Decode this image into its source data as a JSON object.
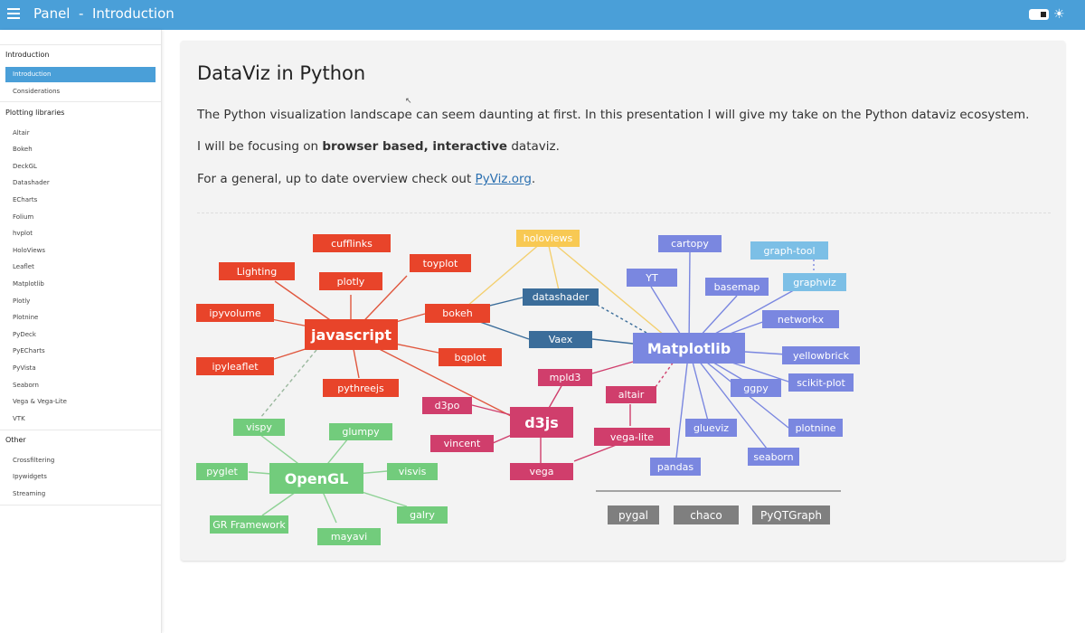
{
  "app": {
    "title": "Panel  -  Introduction"
  },
  "sidebar": {
    "sections": [
      {
        "title": "Introduction",
        "items": [
          "Introduction",
          "Considerations"
        ]
      },
      {
        "title": "Plotting libraries",
        "items": [
          "Altair",
          "Bokeh",
          "DeckGL",
          "Datashader",
          "ECharts",
          "Folium",
          "hvplot",
          "HoloViews",
          "Leaflet",
          "Matplotlib",
          "Plotly",
          "Plotnine",
          "PyDeck",
          "PyECharts",
          "PyVista",
          "Seaborn",
          "Vega & Vega-Lite",
          "VTK"
        ]
      },
      {
        "title": "Other",
        "items": [
          "Crossfiltering",
          "Ipywidgets",
          "Streaming"
        ]
      }
    ]
  },
  "main": {
    "heading": "DataViz in Python",
    "p1": "The Python visualization landscape can seem daunting at first. In this presentation I will give my take on the Python dataviz ecosystem.",
    "p2_pre": "I will be focusing on ",
    "p2_bold": "browser based, interactive",
    "p2_post": " dataviz.",
    "p3_pre": "For a general, up to date overview check out ",
    "p3_link": "PyViz.org",
    "p3_post": "."
  },
  "diagram": {
    "colors": {
      "red": "#e8442a",
      "pink": "#d03e6c",
      "green": "#72cc7c",
      "blue": "#7a87e0",
      "yellow": "#f8c953",
      "navy": "#3b6d9a",
      "light": "#7cbfe6",
      "gray": "#7f7f7f"
    },
    "nodes": {
      "javascript": "javascript",
      "cufflinks": "cufflinks",
      "plotly": "plotly",
      "lighting": "Lighting",
      "toyplot": "toyplot",
      "ipyvolume": "ipyvolume",
      "ipyleaflet": "ipyleaflet",
      "pythreejs": "pythreejs",
      "bokeh": "bokeh",
      "bqplot": "bqplot",
      "holoviews": "holoviews",
      "datashader": "datashader",
      "vaex": "Vaex",
      "d3js": "d3js",
      "mpld3": "mpld3",
      "d3po": "d3po",
      "vincent": "vincent",
      "vega": "vega",
      "altair": "altair",
      "vegalite": "vega-lite",
      "matplotlib": "Matplotlib",
      "cartopy": "cartopy",
      "yt": "YT",
      "basemap": "basemap",
      "graphtool": "graph-tool",
      "graphviz": "graphviz",
      "networkx": "networkx",
      "yellowbrick": "yellowbrick",
      "scikitplot": "scikit-plot",
      "ggpy": "ggpy",
      "glueviz": "glueviz",
      "plotnine": "plotnine",
      "pandas": "pandas",
      "seaborn": "seaborn",
      "opengl": "OpenGL",
      "vispy": "vispy",
      "glumpy": "glumpy",
      "pyglet": "pyglet",
      "visvis": "visvis",
      "grframework": "GR Framework",
      "galry": "galry",
      "mayavi": "mayavi",
      "pygal": "pygal",
      "chaco": "chaco",
      "pyqtgraph": "PyQTGraph"
    }
  }
}
